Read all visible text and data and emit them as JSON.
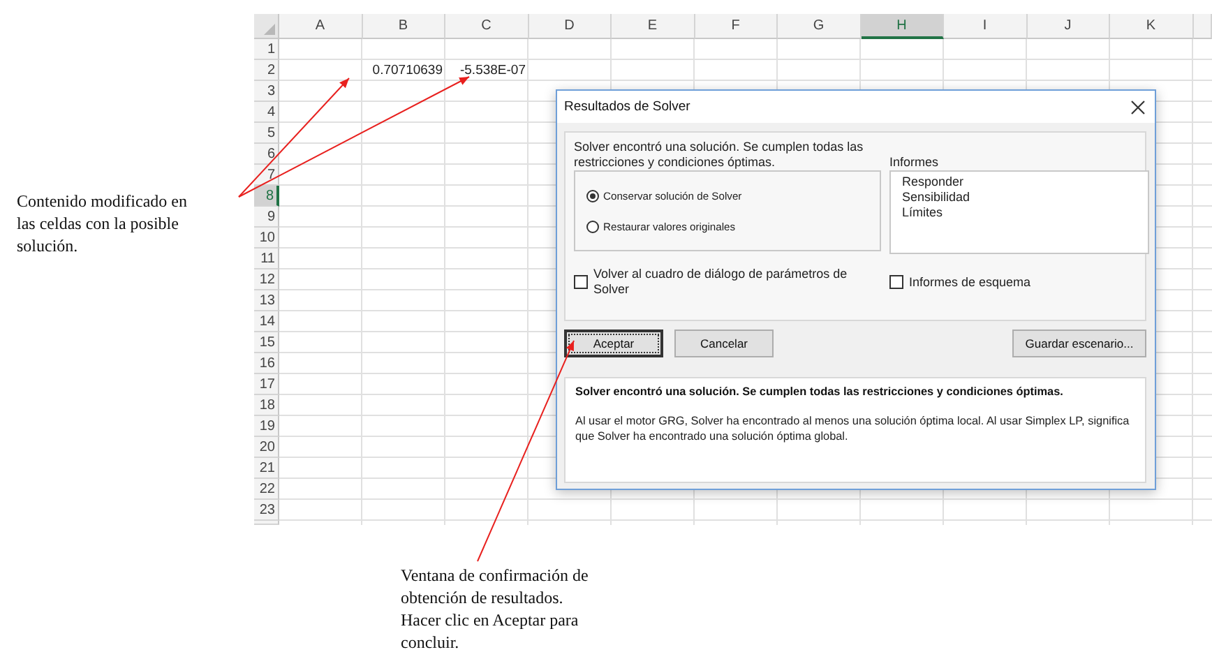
{
  "sheet": {
    "columns": [
      {
        "label": "A",
        "selected": false
      },
      {
        "label": "B",
        "selected": false
      },
      {
        "label": "C",
        "selected": false
      },
      {
        "label": "D",
        "selected": false
      },
      {
        "label": "E",
        "selected": false
      },
      {
        "label": "F",
        "selected": false
      },
      {
        "label": "G",
        "selected": false
      },
      {
        "label": "H",
        "selected": true
      },
      {
        "label": "I",
        "selected": false
      },
      {
        "label": "J",
        "selected": false
      },
      {
        "label": "K",
        "selected": false
      }
    ],
    "rows": [
      {
        "label": "1",
        "selected": false
      },
      {
        "label": "2",
        "selected": false,
        "cells": [
          null,
          "0.70710639",
          "-5.538E-07"
        ]
      },
      {
        "label": "3",
        "selected": false
      },
      {
        "label": "4",
        "selected": false
      },
      {
        "label": "5",
        "selected": false
      },
      {
        "label": "6",
        "selected": false
      },
      {
        "label": "7",
        "selected": false
      },
      {
        "label": "8",
        "selected": true
      },
      {
        "label": "9",
        "selected": false
      },
      {
        "label": "10",
        "selected": false
      },
      {
        "label": "11",
        "selected": false
      },
      {
        "label": "12",
        "selected": false
      },
      {
        "label": "13",
        "selected": false
      },
      {
        "label": "14",
        "selected": false
      },
      {
        "label": "15",
        "selected": false
      },
      {
        "label": "16",
        "selected": false
      },
      {
        "label": "17",
        "selected": false
      },
      {
        "label": "18",
        "selected": false
      },
      {
        "label": "19",
        "selected": false
      },
      {
        "label": "20",
        "selected": false
      },
      {
        "label": "21",
        "selected": false
      },
      {
        "label": "22",
        "selected": false
      },
      {
        "label": "23",
        "selected": false
      }
    ]
  },
  "dialog": {
    "title": "Resultados de Solver",
    "message": "Solver encontró una solución. Se cumplen todas las restricciones y condiciones óptimas.",
    "options": [
      {
        "label": "Conservar solución de Solver",
        "selected": true
      },
      {
        "label": "Restaurar valores originales",
        "selected": false
      }
    ],
    "reports_label": "Informes",
    "reports": [
      "Responder",
      "Sensibilidad",
      "Límites"
    ],
    "checkboxes": [
      {
        "label": "Volver al cuadro de diálogo de parámetros de Solver",
        "checked": false
      },
      {
        "label": "Informes de esquema",
        "checked": false
      }
    ],
    "buttons": [
      {
        "label": "Aceptar",
        "default": true
      },
      {
        "label": "Cancelar",
        "default": false
      },
      {
        "label": "Guardar escenario...",
        "default": false
      }
    ],
    "details_title": "Solver encontró una solución. Se cumplen todas las restricciones y condiciones óptimas.",
    "details_text": "Al usar el motor GRG, Solver ha encontrado al menos una solución óptima local. Al usar Simplex LP, significa que Solver ha encontrado una solución óptima global."
  },
  "annotations": [
    {
      "text": "Contenido modificado en las celdas con la posible solución."
    },
    {
      "text": "Ventana de confirmación de obtención de resultados. Hacer clic en Aceptar para concluir."
    }
  ]
}
